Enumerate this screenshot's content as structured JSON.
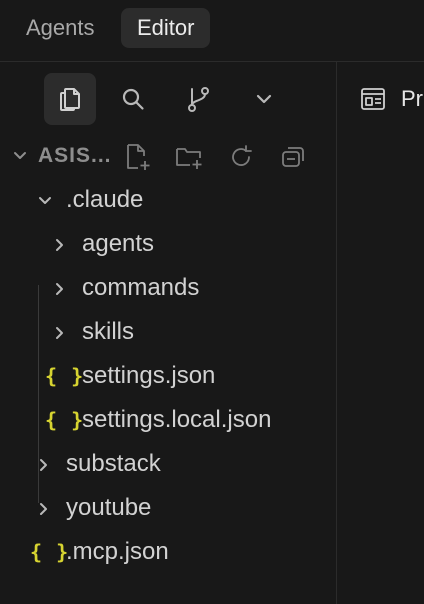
{
  "top_tabs": [
    {
      "label": "Agents",
      "active": false
    },
    {
      "label": "Editor",
      "active": true
    }
  ],
  "activity_bar": {
    "icons": [
      "explorer-icon",
      "search-icon",
      "source-control-icon",
      "chevron-down-icon"
    ],
    "selected": "explorer-icon"
  },
  "explorer": {
    "section_title": "ASIS...",
    "actions": [
      "new-file-icon",
      "new-folder-icon",
      "refresh-icon",
      "collapse-all-icon"
    ],
    "tree": [
      {
        "label": ".claude",
        "kind": "folder",
        "expanded": true
      },
      {
        "label": "agents",
        "kind": "folder",
        "expanded": false
      },
      {
        "label": "commands",
        "kind": "folder",
        "expanded": false
      },
      {
        "label": "skills",
        "kind": "folder",
        "expanded": false
      },
      {
        "label": "settings.json",
        "kind": "json"
      },
      {
        "label": "settings.local.json",
        "kind": "json"
      },
      {
        "label": "substack",
        "kind": "folder",
        "expanded": false
      },
      {
        "label": "youtube",
        "kind": "folder",
        "expanded": false
      },
      {
        "label": ".mcp.json",
        "kind": "json"
      }
    ],
    "json_glyph": "{ }"
  },
  "editor": {
    "tab_label_visible": "Pr"
  },
  "colors": {
    "background": "#181818",
    "active_tab": "#2c2c2c",
    "json_icon": "#d7d431",
    "border": "#2b2b2b"
  }
}
